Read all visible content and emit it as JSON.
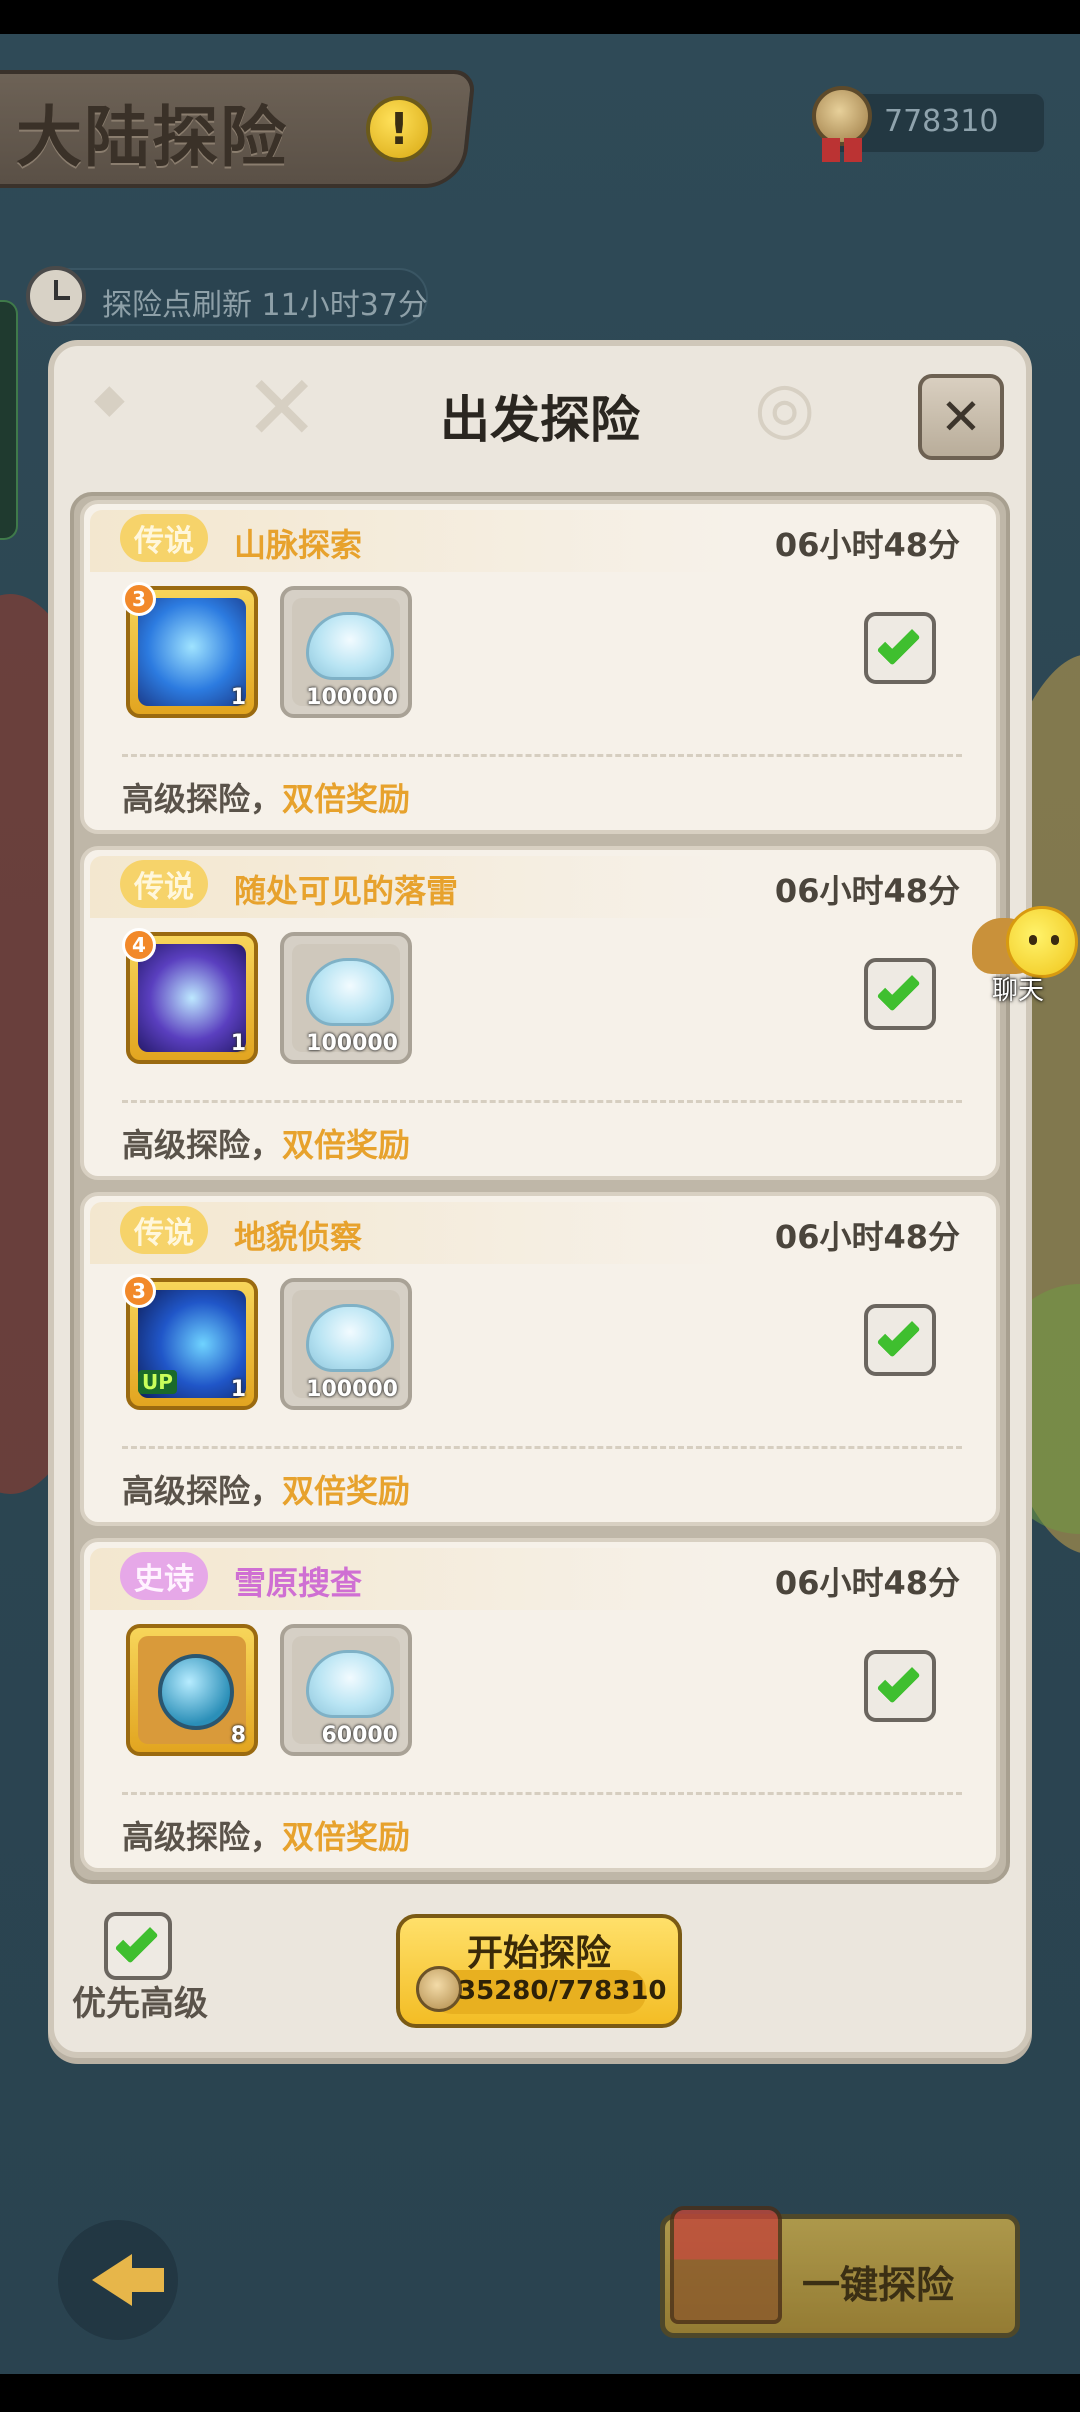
{
  "header": {
    "title": "大陆探险",
    "warning_icon": "exclamation-icon",
    "currency_value": "778310",
    "refresh_text": "探险点刷新  11小时37分"
  },
  "modal": {
    "title": "出发探险",
    "close_icon": "close-icon",
    "quests": [
      {
        "rarity": "传说",
        "name": "山脉探索",
        "duration": "06小时48分",
        "skill_level": "3",
        "skill_count": "1",
        "shell_count": "100000",
        "bonus_prefix": "高级探险，",
        "bonus_highlight": "双倍奖励",
        "checked": true
      },
      {
        "rarity": "传说",
        "name": "随处可见的落雷",
        "duration": "06小时48分",
        "skill_level": "4",
        "skill_count": "1",
        "shell_count": "100000",
        "bonus_prefix": "高级探险，",
        "bonus_highlight": "双倍奖励",
        "checked": true
      },
      {
        "rarity": "传说",
        "name": "地貌侦察",
        "duration": "06小时48分",
        "skill_level": "3",
        "skill_badge": "UP",
        "skill_count": "1",
        "shell_count": "100000",
        "bonus_prefix": "高级探险，",
        "bonus_highlight": "双倍奖励",
        "checked": true
      },
      {
        "rarity": "史诗",
        "name": "雪原搜查",
        "duration": "06小时48分",
        "item_count": "8",
        "shell_count": "60000",
        "bonus_prefix": "高级探险，",
        "bonus_highlight": "双倍奖励",
        "checked": true
      }
    ],
    "priority_label": "优先高级",
    "priority_checked": true,
    "start_label": "开始探险",
    "start_cost": "35280/778310"
  },
  "chat": {
    "label": "聊天"
  },
  "bottom": {
    "back_icon": "back-arrow-icon",
    "onekey_label": "一键探险"
  },
  "colors": {
    "legend": "#e7a22d",
    "epic": "#cf6fd3",
    "check": "#3fbf2f",
    "accent_gold": "#f3bd25"
  }
}
